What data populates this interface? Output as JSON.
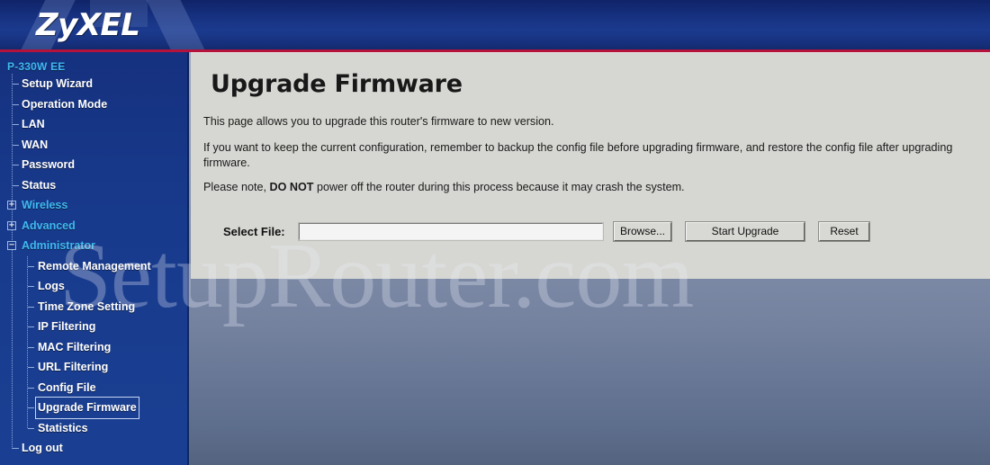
{
  "header": {
    "brand": "ZyXEL",
    "accent_red": "#b5123c",
    "brand_blue": "#16307e"
  },
  "sidebar": {
    "root_label": "P-330W EE",
    "items": [
      {
        "label": "Setup Wizard",
        "level": 1,
        "type": "leaf"
      },
      {
        "label": "Operation Mode",
        "level": 1,
        "type": "leaf"
      },
      {
        "label": "LAN",
        "level": 1,
        "type": "leaf"
      },
      {
        "label": "WAN",
        "level": 1,
        "type": "leaf"
      },
      {
        "label": "Password",
        "level": 1,
        "type": "leaf"
      },
      {
        "label": "Status",
        "level": 1,
        "type": "leaf"
      },
      {
        "label": "Wireless",
        "level": 1,
        "type": "group",
        "expanded": false,
        "toggle": "+"
      },
      {
        "label": "Advanced",
        "level": 1,
        "type": "group",
        "expanded": false,
        "toggle": "+"
      },
      {
        "label": "Administrator",
        "level": 1,
        "type": "group",
        "expanded": true,
        "toggle": "−"
      },
      {
        "label": "Remote Management",
        "level": 2,
        "type": "leaf"
      },
      {
        "label": "Logs",
        "level": 2,
        "type": "leaf"
      },
      {
        "label": "Time Zone Setting",
        "level": 2,
        "type": "leaf"
      },
      {
        "label": "IP Filtering",
        "level": 2,
        "type": "leaf"
      },
      {
        "label": "MAC Filtering",
        "level": 2,
        "type": "leaf"
      },
      {
        "label": "URL Filtering",
        "level": 2,
        "type": "leaf"
      },
      {
        "label": "Config File",
        "level": 2,
        "type": "leaf"
      },
      {
        "label": "Upgrade Firmware",
        "level": 2,
        "type": "leaf",
        "selected": true
      },
      {
        "label": "Statistics",
        "level": 2,
        "type": "leaf",
        "last": true
      },
      {
        "label": "Log out",
        "level": 1,
        "type": "leaf",
        "tail": true
      }
    ]
  },
  "main": {
    "title": "Upgrade Firmware",
    "paragraph_1": "This page allows you to upgrade this router's firmware to new version.",
    "paragraph_2": "If you want to keep the current configuration, remember to backup the config file before upgrading firmware, and restore the config file after upgrading firmware.",
    "paragraph_3_prefix": "Please note, ",
    "paragraph_3_bold": "DO NOT",
    "paragraph_3_suffix": " power off the router during this process because it may crash the system.",
    "form": {
      "select_file_label": "Select File:",
      "file_value": "",
      "file_placeholder": "",
      "browse_label": "Browse...",
      "start_upgrade_label": "Start Upgrade",
      "reset_label": "Reset"
    }
  },
  "watermark": {
    "text": "SetupRouter.com"
  }
}
